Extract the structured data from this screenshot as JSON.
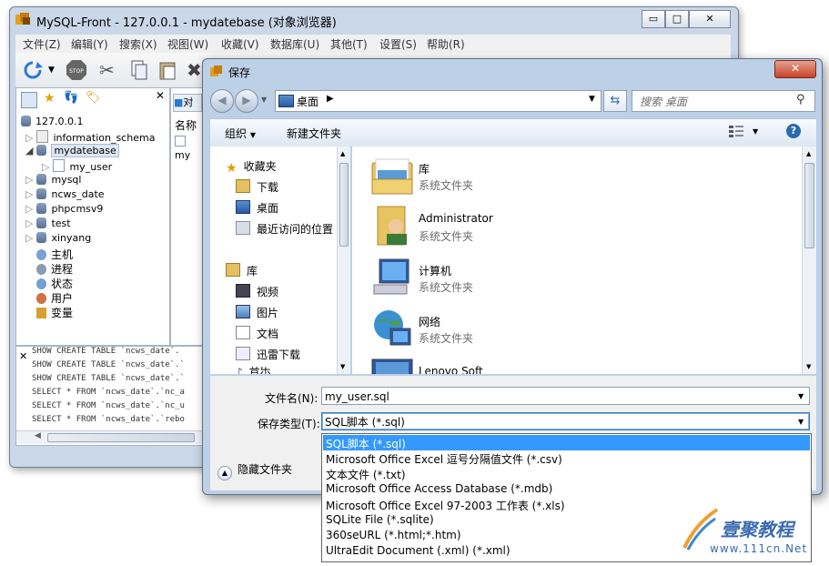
{
  "main_window": {
    "title": "MySQL-Front - 127.0.0.1 - mydatebase (对象浏览器)",
    "menu": [
      "文件(Z)",
      "编辑(Y)",
      "搜索(X)",
      "视图(W)",
      "收藏(V)",
      "数据库(U)",
      "其他(T)",
      "设置(S)",
      "帮助(R)"
    ],
    "content_tab": "对",
    "column_header": "名称",
    "row_text": "my",
    "tree": [
      {
        "label": "127.0.0.1"
      },
      {
        "label": "information_schema"
      },
      {
        "label": "mydatebase"
      },
      {
        "label": "my_user"
      },
      {
        "label": "mysql"
      },
      {
        "label": "ncws_date"
      },
      {
        "label": "phpcmsv9"
      },
      {
        "label": "test"
      },
      {
        "label": "xinyang"
      },
      {
        "label": "主机"
      },
      {
        "label": "进程"
      },
      {
        "label": "状态"
      },
      {
        "label": "用户"
      },
      {
        "label": "变量"
      }
    ],
    "sql_log": [
      "SHOW CREATE TABLE `ncws_date`.",
      "SHOW CREATE TABLE `ncws_date`.`",
      "SHOW CREATE TABLE `ncws_date`.`",
      "SELECT * FROM `ncws_date`.`nc_a",
      "SELECT * FROM `ncws_date`.`nc_u",
      "SELECT * FROM `ncws_date`.`rebo"
    ]
  },
  "dialog": {
    "title": "保存",
    "address": "桌面",
    "search_placeholder": "搜索 桌面",
    "organize_label": "组织",
    "new_folder_label": "新建文件夹",
    "nav_items": {
      "favorites": "收藏夹",
      "downloads": "下载",
      "desktop": "桌面",
      "recent": "最近访问的位置",
      "library": "库",
      "videos": "视频",
      "pictures": "图片",
      "documents": "文档",
      "xunlei": "迅雷下载",
      "music": "音乐"
    },
    "files": [
      {
        "name": "库",
        "type": "系统文件夹"
      },
      {
        "name": "Administrator",
        "type": "系统文件夹"
      },
      {
        "name": "计算机",
        "type": "系统文件夹"
      },
      {
        "name": "网络",
        "type": "系统文件夹"
      },
      {
        "name": "Lenovo Soft",
        "type": ""
      }
    ],
    "filename_label": "文件名(N):",
    "filename_value": "my_user.sql",
    "filetype_label": "保存类型(T):",
    "filetype_value": "SQL脚本 (*.sql)",
    "hide_folders_label": "隐藏文件夹",
    "filetype_options": [
      "SQL脚本 (*.sql)",
      "Microsoft Office Excel 逗号分隔值文件 (*.csv)",
      "文本文件 (*.txt)",
      "Microsoft Office Access Database (*.mdb)",
      "Microsoft Office Excel 97-2003 工作表 (*.xls)",
      "SQLite File (*.sqlite)",
      "360seURL (*.html;*.htm)",
      "UltraEdit Document (.xml) (*.xml)"
    ],
    "selected_option_color": "#3399ff"
  },
  "watermark": {
    "text": "壹聚教程",
    "url": "www.111cn.Net"
  }
}
